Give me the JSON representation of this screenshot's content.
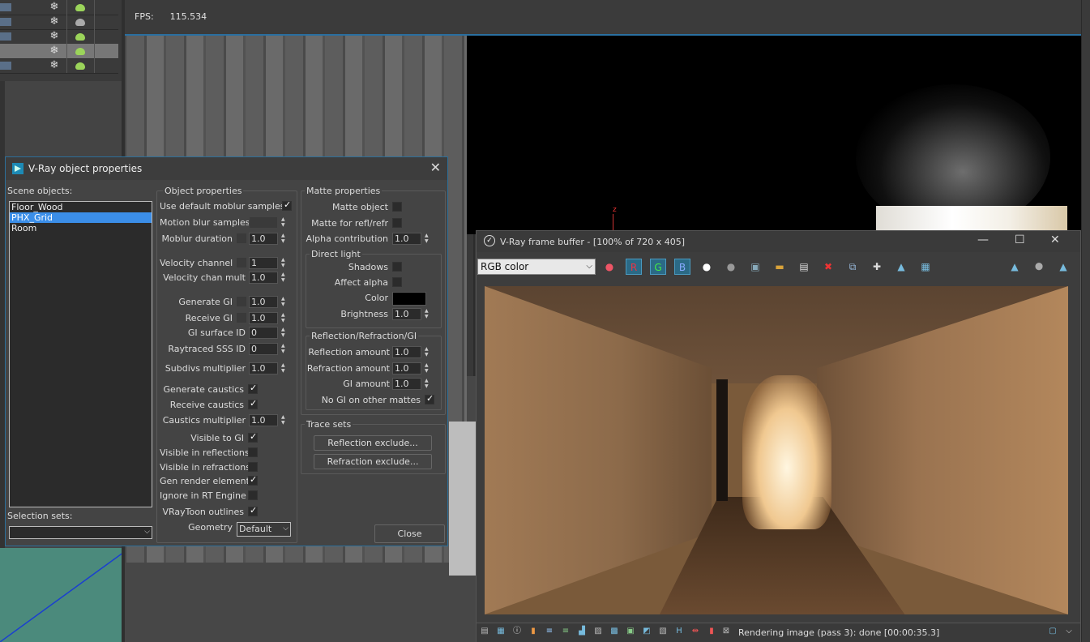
{
  "viewport": {
    "fps_label": "FPS:",
    "fps_value": "115.534",
    "axis_label": "z"
  },
  "dialog": {
    "title": "V-Ray object properties",
    "close_glyph": "✕",
    "scene_objects_label": "Scene objects:",
    "scene_objects": [
      "Floor_Wood",
      "PHX_Grid",
      "Room"
    ],
    "selected_object": "PHX_Grid",
    "selection_sets_label": "Selection sets:",
    "selection_sets_value": "",
    "object_properties": {
      "header": "Object properties",
      "use_default_moblur": "Use default moblur samples",
      "motion_blur_samples": "Motion blur samples",
      "moblur_duration": "Moblur duration",
      "moblur_duration_value": "1.0",
      "velocity_channel": "Velocity channel",
      "velocity_channel_value": "1",
      "velocity_chan_mult": "Velocity chan mult",
      "velocity_chan_mult_value": "1.0",
      "generate_gi": "Generate GI",
      "generate_gi_value": "1.0",
      "receive_gi": "Receive GI",
      "receive_gi_value": "1.0",
      "gi_surface_id": "GI surface ID",
      "gi_surface_id_value": "0",
      "raytraced_sss_id": "Raytraced SSS ID",
      "raytraced_sss_id_value": "0",
      "subdivs_multiplier": "Subdivs multiplier",
      "subdivs_multiplier_value": "1.0",
      "generate_caustics": "Generate caustics",
      "receive_caustics": "Receive caustics",
      "caustics_multiplier": "Caustics multiplier",
      "caustics_multiplier_value": "1.0",
      "visible_to_gi": "Visible to GI",
      "visible_in_reflections": "Visible in reflections",
      "visible_in_refractions": "Visible in refractions",
      "gen_render_elements": "Gen render elements",
      "ignore_in_rt": "Ignore in RT Engine",
      "vraytoon_outlines": "VRayToon outlines",
      "geometry": "Geometry",
      "geometry_value": "Default"
    },
    "matte_properties": {
      "header": "Matte properties",
      "matte_object": "Matte object",
      "matte_for_refl": "Matte for refl/refr",
      "alpha_contribution": "Alpha contribution",
      "alpha_contribution_value": "1.0",
      "direct_light_header": "Direct light",
      "shadows": "Shadows",
      "affect_alpha": "Affect alpha",
      "color": "Color",
      "color_value": "#000000",
      "brightness": "Brightness",
      "brightness_value": "1.0",
      "rrgi_header": "Reflection/Refraction/GI",
      "reflection_amount": "Reflection amount",
      "reflection_amount_value": "1.0",
      "refraction_amount": "Refraction amount",
      "refraction_amount_value": "1.0",
      "gi_amount": "GI amount",
      "gi_amount_value": "1.0",
      "no_gi_other_mattes": "No GI on other mattes"
    },
    "trace_sets": {
      "header": "Trace sets",
      "reflection_exclude": "Reflection exclude...",
      "refraction_exclude": "Refraction exclude..."
    },
    "close_button": "Close"
  },
  "vfb": {
    "title": "V-Ray frame buffer - [100% of 720 x 405]",
    "minimize": "—",
    "maximize": "☐",
    "close": "✕",
    "channel_select": "RGB color",
    "ch_r": "R",
    "ch_g": "G",
    "ch_b": "B",
    "status": "Rendering image (pass 3): done [00:00:35.3]"
  }
}
